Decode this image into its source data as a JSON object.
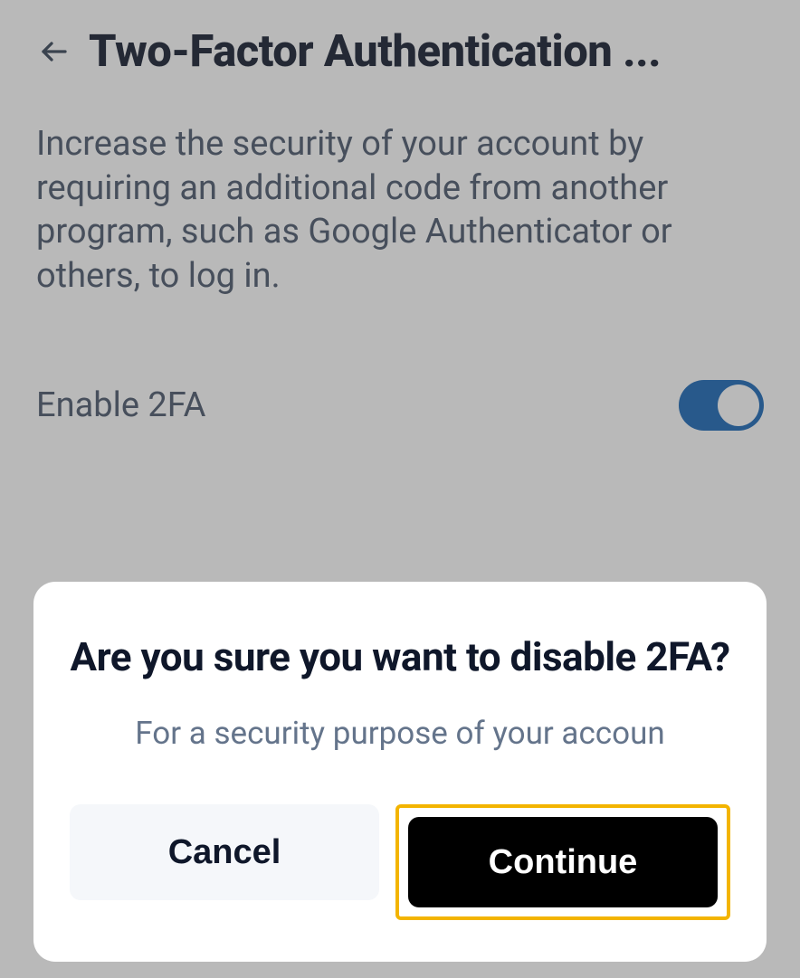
{
  "header": {
    "title": "Two-Factor Authentication ..."
  },
  "description": "Increase the security of your account by requiring an additional code from another program, such as Google Authenticator or others, to log in.",
  "toggle": {
    "label": "Enable 2FA",
    "enabled": true
  },
  "dialog": {
    "title": "Are you sure you want to disable 2FA?",
    "subtitle": "For a security purpose of your accoun",
    "cancel_label": "Cancel",
    "continue_label": "Continue"
  },
  "colors": {
    "accent": "#1565b5",
    "highlight_border": "#f3b400"
  }
}
